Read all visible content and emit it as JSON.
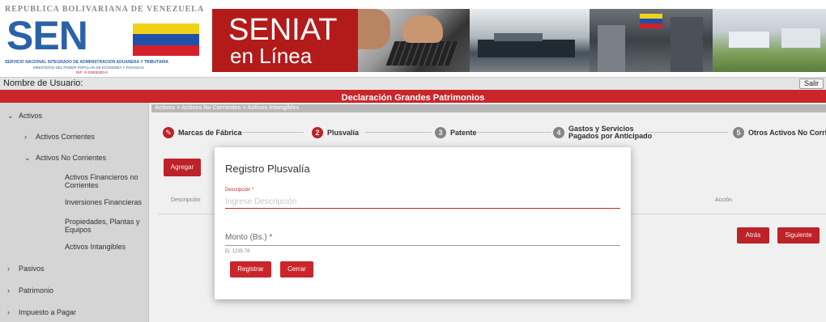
{
  "banner": {
    "republic_text": "REPUBLICA BOLIVARIANA DE VENEZUELA",
    "logo_text": "SENIAT",
    "logo_sub1": "SERVICIO NACIONAL INTEGRADO DE ADMINISTRACION ADUANERA Y TRIBUTARIA",
    "logo_sub2": "MINISTERIO DEL PODER POPULAR DE ECONOMIA Y FINANZAS",
    "logo_sub3": "RIF: G-20000303-0",
    "online_line1": "SENIAT",
    "online_line2": "en Línea"
  },
  "userbar": {
    "label": "Nombre de Usuario:",
    "logout": "Salir"
  },
  "title": "Declaración Grandes Patrimonios",
  "sidebar": {
    "activos": "Activos",
    "activos_corrientes": "Activos Corrientes",
    "activos_no_corrientes": "Activos No Corrientes",
    "sub_items": [
      "Activos Financieros no Corrientes",
      "Inversiones Financieras",
      "Propiedades, Plantas y Equipos",
      "Activos Intangibles"
    ],
    "pasivos": "Pasivos",
    "patrimonio": "Patrimonio",
    "impuesto": "Impuesto a Pagar"
  },
  "breadcrumb": "Activos > Activos No Corrientes > Activos Intangibles",
  "steps": [
    {
      "num": "",
      "label": "Marcas de Fábrica"
    },
    {
      "num": "2",
      "label": "Plusvalía"
    },
    {
      "num": "3",
      "label": "Patente"
    },
    {
      "num": "4",
      "label": "Gastos y Servicios",
      "label2": "Pagados por Anticipado"
    },
    {
      "num": "5",
      "label": "Otros Activos No Corrientes"
    }
  ],
  "main": {
    "add_button": "Agregar",
    "col_descripcion": "Descripción",
    "col_accion": "Acción",
    "back_button": "Atrás",
    "next_button": "Siguiente"
  },
  "dialog": {
    "title": "Registro Plusvalía",
    "desc_label": "Descripción *",
    "desc_placeholder": "Ingrese Descripción",
    "monto_label": "Monto (Bs.) *",
    "monto_hint": "Ej: 1235.78",
    "register_button": "Registrar",
    "close_button": "Cerrar"
  },
  "colors": {
    "brand_red": "#c9252b",
    "logo_blue": "#2a62a8",
    "sidebar_bg": "#e3e3e3"
  },
  "icons": {
    "expand": "chevron-down-icon",
    "collapsed": "chevron-right-icon",
    "step_done": "pencil-icon"
  }
}
